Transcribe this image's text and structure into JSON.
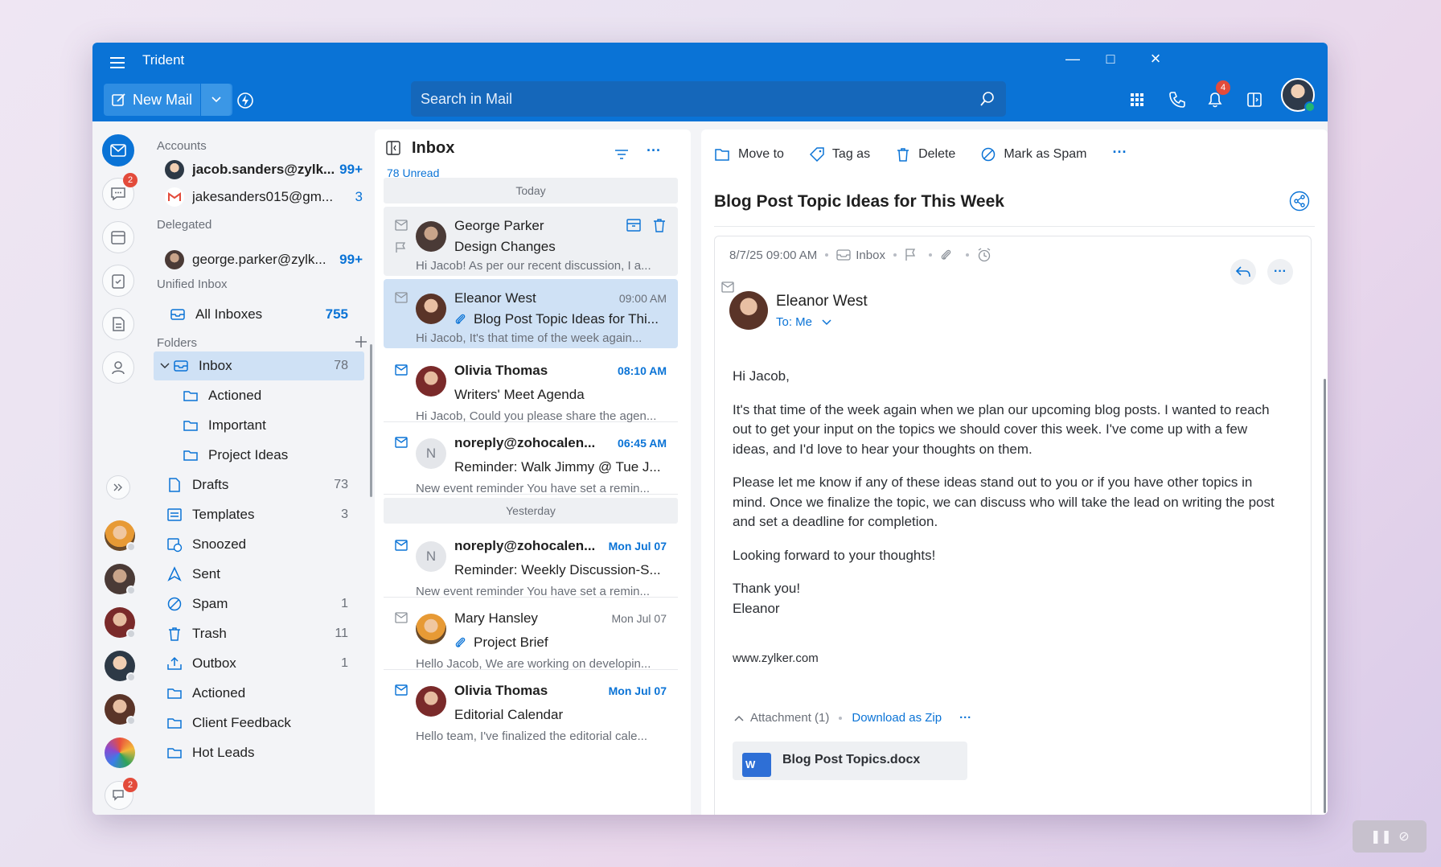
{
  "app": {
    "title": "Trident",
    "new_mail_label": "New Mail",
    "search_placeholder": "Search in Mail",
    "notification_count": "4",
    "accent": "#0a73d6"
  },
  "rail": {
    "chat_badge": "2",
    "bottom_badge": "2"
  },
  "folders": {
    "accounts_label": "Accounts",
    "accounts": [
      {
        "name": "jacob.sanders@zylk...",
        "count": "99+"
      },
      {
        "name": "jakesanders015@gm...",
        "count": "3"
      }
    ],
    "delegated_label": "Delegated",
    "delegated": [
      {
        "name": "george.parker@zylk...",
        "count": "99+"
      }
    ],
    "unified_label": "Unified Inbox",
    "all_inboxes": {
      "name": "All Inboxes",
      "count": "755"
    },
    "folders_label": "Folders",
    "items": [
      {
        "name": "Inbox",
        "count": "78"
      },
      {
        "name": "Actioned",
        "count": ""
      },
      {
        "name": "Important",
        "count": ""
      },
      {
        "name": "Project Ideas",
        "count": ""
      },
      {
        "name": "Drafts",
        "count": "73"
      },
      {
        "name": "Templates",
        "count": "3"
      },
      {
        "name": "Snoozed",
        "count": ""
      },
      {
        "name": "Sent",
        "count": ""
      },
      {
        "name": "Spam",
        "count": "1"
      },
      {
        "name": "Trash",
        "count": "11"
      },
      {
        "name": "Outbox",
        "count": "1"
      },
      {
        "name": "Actioned",
        "count": ""
      },
      {
        "name": "Client Feedback",
        "count": ""
      },
      {
        "name": "Hot Leads",
        "count": ""
      }
    ]
  },
  "list": {
    "title": "Inbox",
    "unread": "78 Unread",
    "today": "Today",
    "yesterday": "Yesterday",
    "mails": [
      {
        "from": "George Parker",
        "time": "",
        "subject": "Design Changes",
        "preview": "Hi Jacob! As per our recent discussion, I a..."
      },
      {
        "from": "Eleanor West",
        "time": "09:00 AM",
        "subject": "Blog Post Topic Ideas for Thi...",
        "preview": "Hi Jacob, It's that time of the week again..."
      },
      {
        "from": "Olivia Thomas",
        "time": "08:10 AM",
        "subject": "Writers' Meet Agenda",
        "preview": "Hi Jacob, Could you please share the agen..."
      },
      {
        "from": "noreply@zohocalen...",
        "time": "06:45 AM",
        "subject": "Reminder: Walk Jimmy @ Tue J...",
        "preview": "New event reminder You have set a remin...",
        "initial": "N"
      },
      {
        "from": "noreply@zohocalen...",
        "time": "Mon Jul 07",
        "subject": "Reminder: Weekly Discussion-S...",
        "preview": "New event reminder You have set a remin...",
        "initial": "N"
      },
      {
        "from": "Mary Hansley",
        "time": "Mon Jul 07",
        "subject": "Project Brief",
        "preview": "Hello Jacob, We are working on developin..."
      },
      {
        "from": "Olivia Thomas",
        "time": "Mon Jul 07",
        "subject": "Editorial Calendar",
        "preview": "Hello team, I've finalized the editorial cale..."
      }
    ]
  },
  "reader": {
    "tools": {
      "move": "Move to",
      "tag": "Tag as",
      "delete": "Delete",
      "spam": "Mark as Spam"
    },
    "subject": "Blog Post Topic Ideas for This Week",
    "date": "8/7/25 09:00 AM",
    "folder": "Inbox",
    "sender": "Eleanor West",
    "to": "To: Me",
    "body": {
      "greeting": "Hi Jacob,",
      "p1": "It's that time of the week again when we plan our upcoming blog posts. I wanted to reach out to get your input on the topics we should cover this week. I've come up with a few ideas, and I'd love to hear your thoughts on them.",
      "p2": "Please let me know if any of these ideas stand out to you or if you have other topics in mind. Once we finalize the topic, we can discuss who will take the lead on writing the post and set a deadline for completion.",
      "p3": "Looking forward to your thoughts!",
      "thanks": "Thank you!",
      "name": "Eleanor",
      "site": "www.zylker.com"
    },
    "attachment_label": "Attachment (1)",
    "download_zip": "Download as Zip",
    "file_name": "Blog Post Topics.docx"
  }
}
